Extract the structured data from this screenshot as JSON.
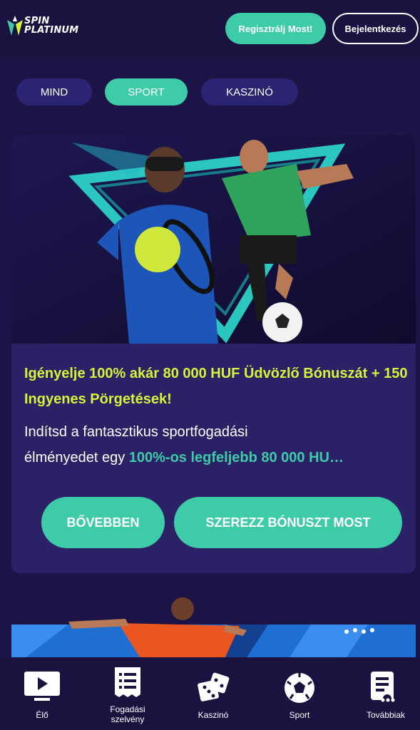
{
  "header": {
    "logo_text_1": "SPIN",
    "logo_text_2": "PLATINUM",
    "register_label": "Regisztrálj Most!",
    "login_label": "Bejelentkezés"
  },
  "filters": [
    {
      "label": "MIND",
      "active": false
    },
    {
      "label": "SPORT",
      "active": true
    },
    {
      "label": "KASZINÓ",
      "active": false
    }
  ],
  "promo": {
    "headline": "Igényelje 100% akár 80 000 HUF Üdvözlő Bónuszát + 150 Ingyenes Pörgetések!",
    "desc_part1": "Indítsd a fantasztikus sportfogadási",
    "desc_part2": "élményedet egy ",
    "desc_highlight": "100%-os legfeljebb 80 000 HU…",
    "more_label": "BŐVEBBEN",
    "claim_label": "SZEREZZ BÓNUSZT MOST"
  },
  "bottom_nav": [
    {
      "label": "Élő",
      "icon": "live-icon"
    },
    {
      "label": "Fogadási\nszelvény",
      "icon": "betslip-icon"
    },
    {
      "label": "Kaszinó",
      "icon": "dice-icon"
    },
    {
      "label": "Sport",
      "icon": "soccer-ball-icon"
    },
    {
      "label": "Továbbiak",
      "icon": "more-icon"
    }
  ],
  "colors": {
    "background": "#1c1446",
    "accent": "#3ecba7",
    "headline": "#d6f33b",
    "card": "#2a2166",
    "filter_inactive": "#2b2472"
  }
}
